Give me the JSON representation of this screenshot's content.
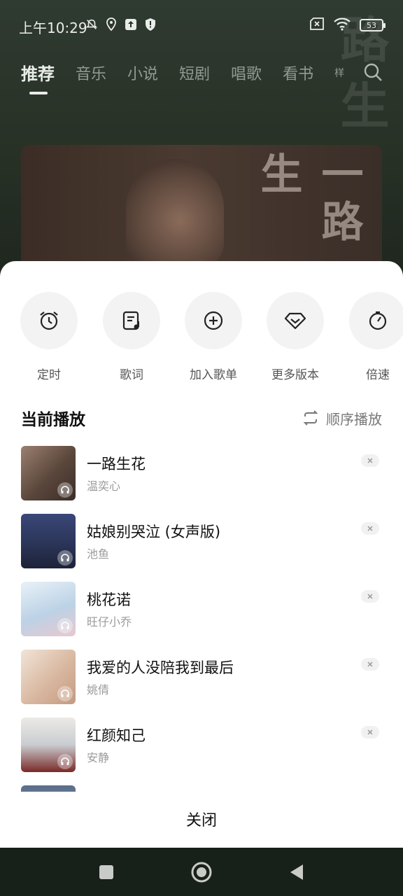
{
  "status_bar": {
    "time": "上午10:29",
    "battery": "53",
    "icons": [
      "mute-icon",
      "location-icon",
      "upload-icon",
      "shield-icon",
      "no-sim-icon",
      "wifi-icon"
    ]
  },
  "top_tabs": [
    {
      "label": "推荐",
      "active": true
    },
    {
      "label": "音乐"
    },
    {
      "label": "小说"
    },
    {
      "label": "短剧"
    },
    {
      "label": "唱歌"
    },
    {
      "label": "看书"
    },
    {
      "label": "样"
    }
  ],
  "banner": {
    "title": "一路生"
  },
  "actions": [
    {
      "label": "定时",
      "icon": "alarm-icon"
    },
    {
      "label": "歌词",
      "icon": "lyrics-icon"
    },
    {
      "label": "加入歌单",
      "icon": "add-circle-icon"
    },
    {
      "label": "更多版本",
      "icon": "versions-icon"
    },
    {
      "label": "倍速",
      "icon": "speed-icon"
    }
  ],
  "queue": {
    "title": "当前播放",
    "play_mode": "顺序播放",
    "songs": [
      {
        "title": "一路生花",
        "artist": "温奕心",
        "cover": "#6b5547"
      },
      {
        "title": "姑娘别哭泣 (女声版)",
        "artist": "池鱼",
        "cover": "#2b3558"
      },
      {
        "title": "桃花诺",
        "artist": "旺仔小乔",
        "cover": "#bcd2e6"
      },
      {
        "title": "我爱的人没陪我到最后",
        "artist": "姚倩",
        "cover": "#d9b8a0"
      },
      {
        "title": "红颜知己",
        "artist": "安静",
        "cover": "#e8e6e2"
      }
    ]
  },
  "close_label": "关闭",
  "nav": [
    "recent-apps",
    "home",
    "back"
  ]
}
